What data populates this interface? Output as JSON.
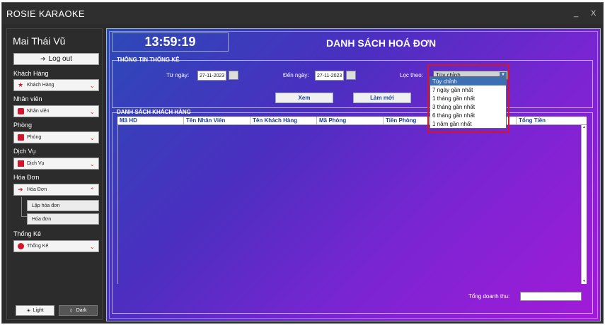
{
  "window": {
    "title": "ROSIE KARAOKE",
    "minimize": "_",
    "close": "X"
  },
  "sidebar": {
    "user_name": "Mai Thái Vũ",
    "logout_label": "Log out",
    "sections": [
      {
        "heading": "Khách Hàng",
        "combo": "Khách Hàng",
        "icon": "star-icon"
      },
      {
        "heading": "Nhân viên",
        "combo": "Nhân viên",
        "icon": "employee-icon"
      },
      {
        "heading": "Phòng",
        "combo": "Phòng",
        "icon": "room-icon"
      },
      {
        "heading": "Dịch Vụ",
        "combo": "Dịch Vụ",
        "icon": "service-icon"
      },
      {
        "heading": "Hóa Đơn",
        "combo": "Hóa Đơn",
        "icon": "invoice-icon"
      },
      {
        "heading": "Thống Kê",
        "combo": "Thống Kê",
        "icon": "chart-icon"
      }
    ],
    "invoice_sub": [
      "Lập hóa đơn",
      "Hóa đơn"
    ],
    "theme_light": "Light",
    "theme_dark": "Dark"
  },
  "main": {
    "clock": "13:59:19",
    "title": "DANH SÁCH HOÁ ĐƠN",
    "stats_group": "THÔNG TIN THỐNG KÊ",
    "from_label": "Từ ngày:",
    "from_value": "27-11-2023",
    "to_label": "Đến ngày:",
    "to_value": "27-11-2023",
    "filter_label": "Lọc theo:",
    "filter_value": "Tùy chỉnh",
    "view_button": "Xem",
    "refresh_button": "Làm mới",
    "list_group": "DANH SÁCH KHÁCH HÀNG",
    "columns": [
      "Mã HD",
      "Tên Nhân Viên",
      "Tên Khách Hàng",
      "Mã Phòng",
      "Tiền Phòng",
      "",
      "Tổng Tiền"
    ],
    "total_label": "Tổng doanh thu:",
    "total_value": "",
    "filter_options": [
      "Tùy chỉnh",
      "7 ngày gần nhất",
      "1 tháng gần nhất",
      "3 tháng gần nhất",
      "6 tháng gần nhất",
      "1 năm gần nhất"
    ]
  },
  "colors": {
    "accent": "#d2152a",
    "highlight": "#3d6fb5",
    "header_text": "#1a3fa0"
  }
}
